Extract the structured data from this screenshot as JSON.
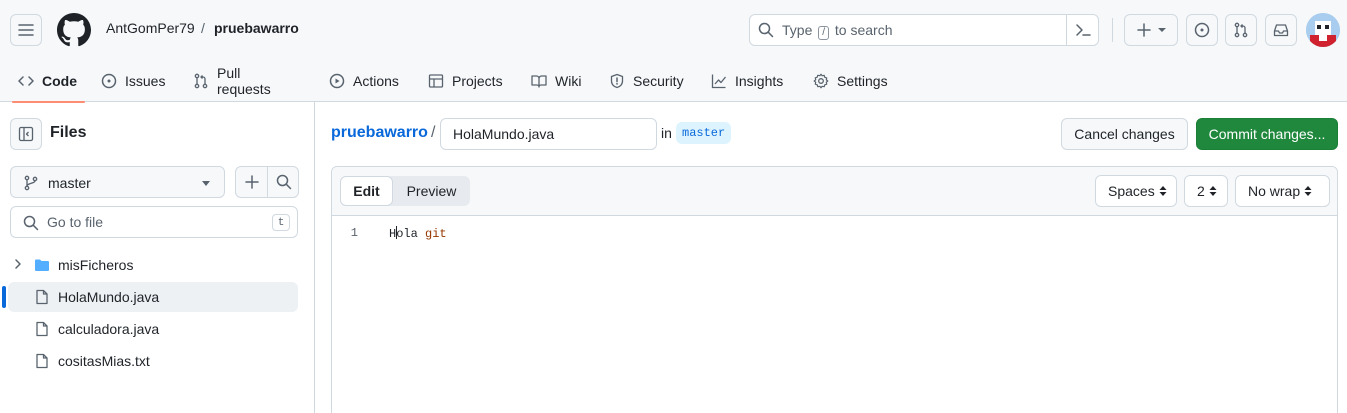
{
  "header": {
    "owner": "AntGomPer79",
    "separator": "/",
    "repo": "pruebawarro",
    "search": {
      "prefix": "Type",
      "key": "/",
      "suffix": "to search"
    }
  },
  "nav": {
    "tabs": [
      {
        "label": "Code",
        "icon": "code-icon",
        "active": true
      },
      {
        "label": "Issues",
        "icon": "issue-opened-icon"
      },
      {
        "label": "Pull requests",
        "icon": "git-pull-request-icon"
      },
      {
        "label": "Actions",
        "icon": "play-icon"
      },
      {
        "label": "Projects",
        "icon": "table-icon"
      },
      {
        "label": "Wiki",
        "icon": "book-icon"
      },
      {
        "label": "Security",
        "icon": "shield-icon"
      },
      {
        "label": "Insights",
        "icon": "graph-icon"
      },
      {
        "label": "Settings",
        "icon": "gear-icon"
      }
    ]
  },
  "sidebar": {
    "title": "Files",
    "branch": "master",
    "goto": {
      "placeholder": "Go to file",
      "shortcut": "t"
    },
    "tree": [
      {
        "name": "misFicheros",
        "type": "folder"
      },
      {
        "name": "HolaMundo.java",
        "type": "file",
        "selected": true
      },
      {
        "name": "calculadora.java",
        "type": "file"
      },
      {
        "name": "cositasMias.txt",
        "type": "file"
      }
    ]
  },
  "main": {
    "repo": "pruebawarro",
    "separator": "/",
    "filename": "HolaMundo.java",
    "in_label": "in",
    "branch": "master",
    "cancel_label": "Cancel changes",
    "commit_label": "Commit changes...",
    "editor": {
      "tab_edit": "Edit",
      "tab_preview": "Preview",
      "indent_mode": "Spaces",
      "indent_size": "2",
      "wrap_mode": "No wrap",
      "lines": [
        {
          "number": "1",
          "text_a": "Hola",
          "text_b": "git"
        }
      ]
    }
  },
  "colors": {
    "accent": "#0969da",
    "commit_green": "#1f883d",
    "tab_underline": "#fd8c73",
    "keyword": "#953800"
  }
}
